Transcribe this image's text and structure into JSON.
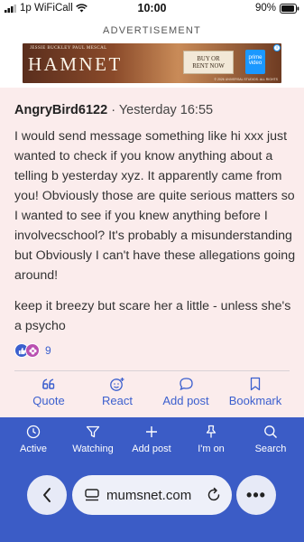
{
  "status_bar": {
    "carrier": "1p WiFiCall",
    "time": "10:00",
    "battery": "90%"
  },
  "ad": {
    "label": "ADVERTISEMENT",
    "credits": "JESSIE BUCKLEY   PAUL MESCAL",
    "title": "HAMNET",
    "buy_line1": "BUY OR",
    "buy_line2": "RENT NOW",
    "prime_line1": "prime",
    "prime_line2": "video",
    "fine_print": "© 2026 UNIVERSAL STUDIOS. ALL RIGHTS"
  },
  "post": {
    "author": "AngryBird6122",
    "separator": "·",
    "timestamp": "Yesterday 16:55",
    "paragraph1": "I would send message something like hi xxx just wanted to check if you know anything about a telling b yesterday xyz. It apparently came from you! Obviously those are quite serious matters so I wanted to see if you knew anything before I involvecschool? It's probably a misunderstanding but Obviously I can't have these allegations going around!",
    "paragraph2": "keep it breezy but scare her a little - unless she's a psycho",
    "reaction_count": "9",
    "actions": {
      "quote": "Quote",
      "react": "React",
      "add_post": "Add post",
      "bookmark": "Bookmark"
    }
  },
  "bottom_nav": {
    "active": "Active",
    "watching": "Watching",
    "add_post": "Add post",
    "im_on": "I'm on",
    "search": "Search"
  },
  "browser": {
    "url": "mumsnet.com",
    "more": "•••"
  },
  "colors": {
    "accent": "#3b5fce",
    "nav_background": "#3b5cc6",
    "post_background": "#fbecec"
  }
}
